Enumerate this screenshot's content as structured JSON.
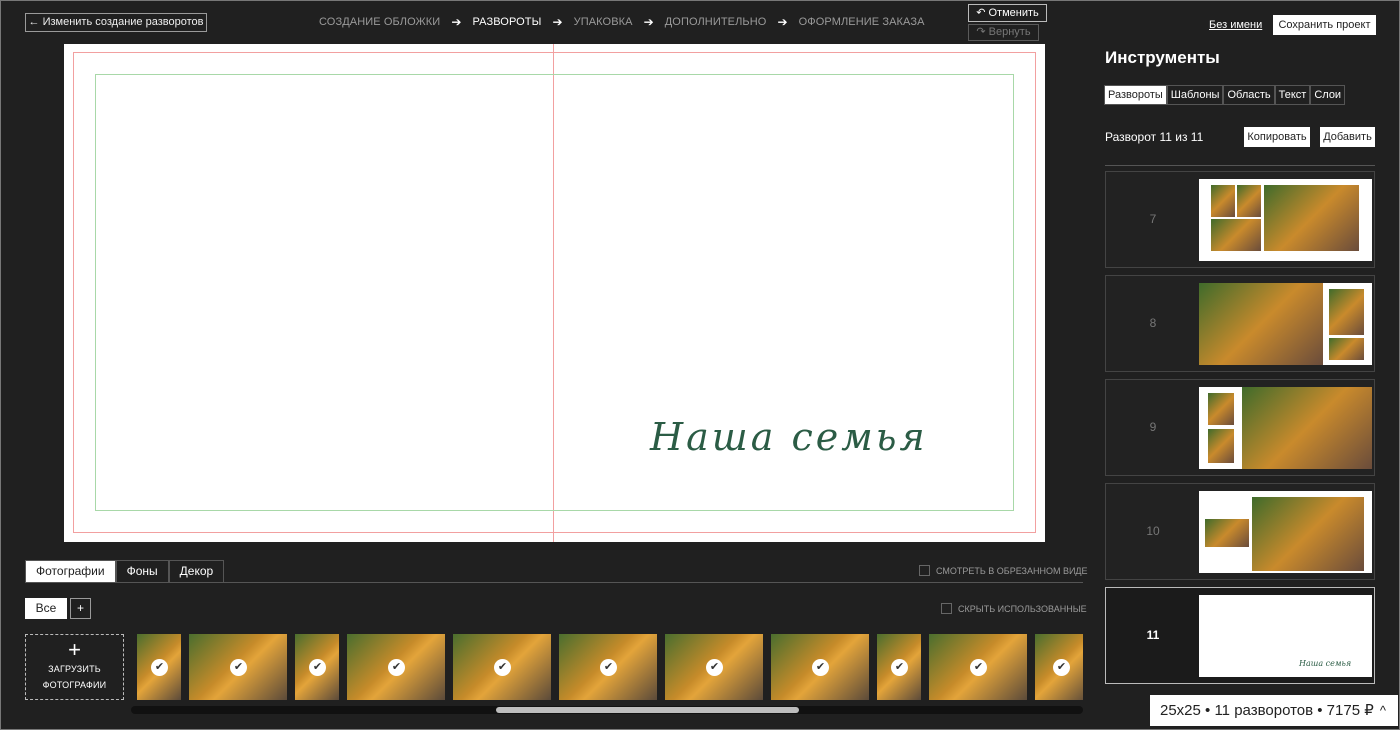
{
  "header": {
    "back_label": "← Изменить создание разворотов",
    "steps": [
      "СОЗДАНИЕ ОБЛОЖКИ",
      "РАЗВОРОТЫ",
      "УПАКОВКА",
      "ДОПОЛНИТЕЛЬНО",
      "ОФОРМЛЕНИЕ ЗАКАЗА"
    ],
    "active_step": "РАЗВОРОТЫ",
    "arrow": "➔",
    "undo_label": "↶ Отменить",
    "redo_label": "↷ Вернуть",
    "project_name": "Без имени",
    "save_label": "Сохранить проект"
  },
  "canvas": {
    "title_text": "Наша семья"
  },
  "bottom": {
    "tabs": [
      "Фотографии",
      "Фоны",
      "Декор"
    ],
    "view_cropped_label": "СМОТРЕТЬ В ОБРЕЗАННОМ ВИДЕ",
    "hide_used_label": "СКРЫТЬ ИСПОЛЬЗОВАННЫЕ",
    "filter_all": "Все",
    "filter_add": "+",
    "upload_plus": "+",
    "upload_line1": "ЗАГРУЗИТЬ",
    "upload_line2": "ФОТОГРАФИИ",
    "check_glyph": "✔",
    "photo_count": 11,
    "scroll_position": 0.4
  },
  "tools": {
    "title": "Инструменты",
    "tabs": [
      "Развороты",
      "Шаблоны",
      "Область",
      "Текст",
      "Слои"
    ],
    "active_tab": "Развороты",
    "spread_count": "Разворот 11 из 11",
    "copy_label": "Копировать",
    "add_label": "Добавить",
    "spreads": [
      {
        "number": "7"
      },
      {
        "number": "8"
      },
      {
        "number": "9"
      },
      {
        "number": "10"
      },
      {
        "number": "11",
        "active": true,
        "mini_title": "Наша семья"
      }
    ]
  },
  "footer": {
    "price_summary": "25x25 • 11 разворотов • 7175 ₽",
    "chevron": "^"
  },
  "colors": {
    "background": "#202020",
    "title_green": "#2b5c45",
    "guide_red": "#f2a0a0",
    "guide_green": "#a8d8a8"
  }
}
